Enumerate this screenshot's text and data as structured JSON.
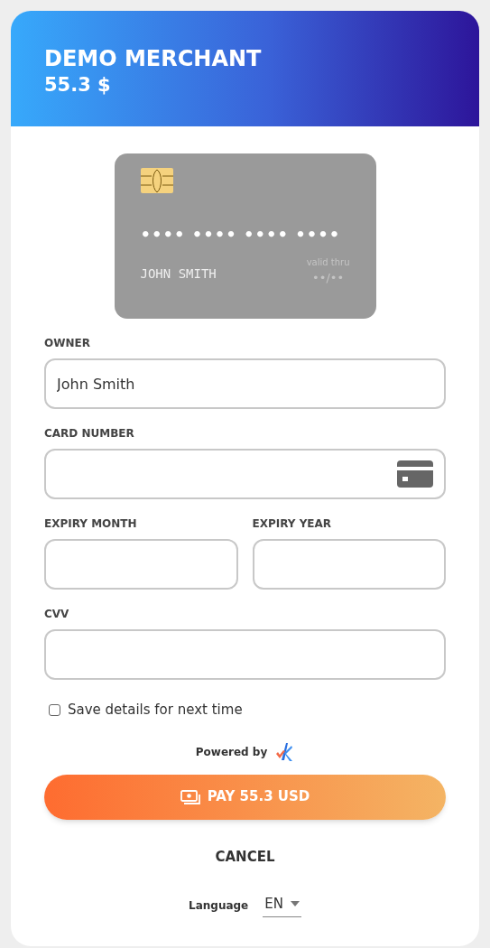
{
  "header": {
    "merchant": "DEMO MERCHANT",
    "amount": "55.3 $"
  },
  "card_preview": {
    "number_mask": "•••• •••• •••• ••••",
    "holder": "JOHN SMITH",
    "valid_label": "valid thru",
    "expiry_mask": "••/••"
  },
  "fields": [
    {
      "label": "OWNER",
      "value": "John Smith",
      "kind": "text"
    },
    {
      "label": "CARD NUMBER",
      "kind": "card"
    },
    {
      "label": "EXPIRY MONTH",
      "kind": "half"
    },
    {
      "label": "EXPIRY YEAR",
      "kind": "half"
    },
    {
      "label": "CVV",
      "kind": "text"
    }
  ],
  "save_details": {
    "label": "Save details for next time",
    "checked": false
  },
  "powered_by": "Powered by",
  "pay_button": "PAY 55.3 USD",
  "cancel_button": "CANCEL",
  "language": {
    "label": "Language",
    "value": "EN"
  }
}
